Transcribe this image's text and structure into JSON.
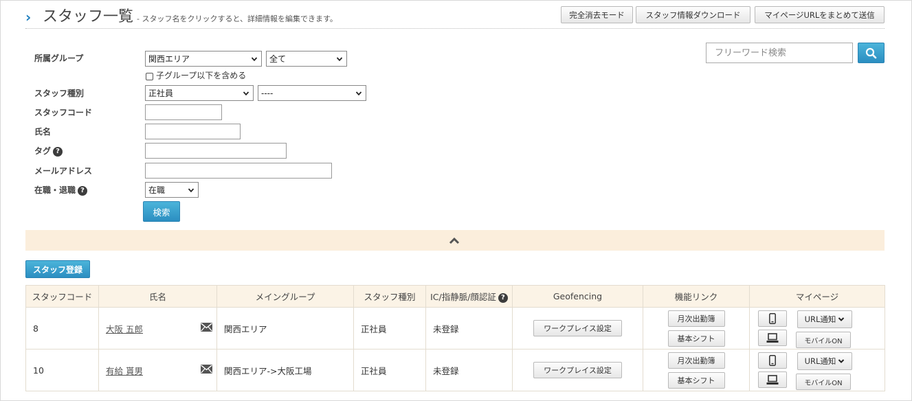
{
  "header": {
    "title": "スタッフ一覧",
    "subtitle": "- スタッフ名をクリックすると、詳細情報を編集できます。",
    "buttons": {
      "delete_mode": "完全消去モード",
      "download": "スタッフ情報ダウンロード",
      "send_urls": "マイページURLをまとめて送信"
    }
  },
  "filters": {
    "group_label": "所属グループ",
    "group_value": "関西エリア",
    "group_sub_value": "全て",
    "include_subgroups_label": "子グループ以下を含める",
    "staff_type_label": "スタッフ種別",
    "staff_type_value": "正社員",
    "staff_type_sub_value": "----",
    "code_label": "スタッフコード",
    "name_label": "氏名",
    "tag_label": "タグ",
    "email_label": "メールアドレス",
    "employment_label": "在職・退職",
    "employment_value": "在職",
    "search_button": "検索"
  },
  "free_search": {
    "placeholder": "フリーワード検索"
  },
  "register_button": "スタッフ登録",
  "table": {
    "headers": [
      "スタッフコード",
      "氏名",
      "メイングループ",
      "スタッフ種別",
      "IC/指静脈/顔認証",
      "Geofencing",
      "機能リンク",
      "マイページ"
    ],
    "workplace_button": "ワークプレイス設定",
    "monthly_button": "月次出勤簿",
    "shift_button": "基本シフト",
    "url_notice_button": "URL通知",
    "mobile_on_button": "モバイルON",
    "rows": [
      {
        "code": "8",
        "name": "大阪 五郎",
        "group": "関西エリア",
        "type": "正社員",
        "auth": "未登録"
      },
      {
        "code": "10",
        "name": "有給 貰男",
        "group": "関西エリア->大阪工場",
        "type": "正社員",
        "auth": "未登録"
      }
    ]
  },
  "colors": {
    "accent": "#2b8ec1",
    "header_bg": "#fbf3e6",
    "collapse_bar": "#fbeedc"
  }
}
